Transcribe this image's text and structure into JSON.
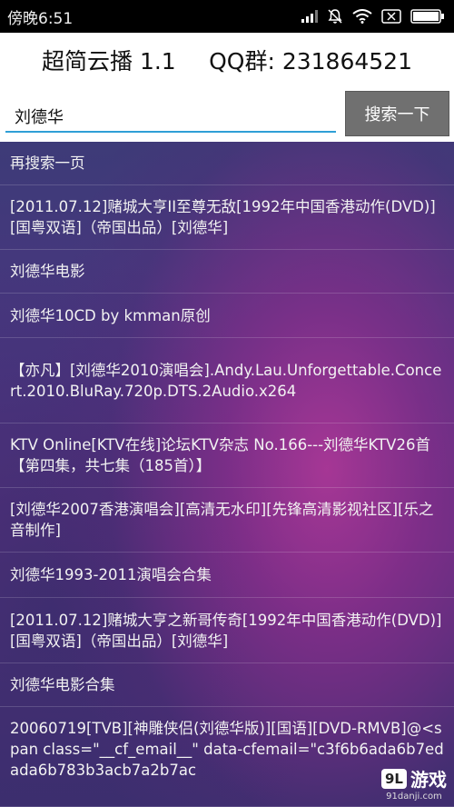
{
  "status_bar": {
    "time": "傍晚6:51",
    "icons": [
      "signal-icon",
      "bell-off-icon",
      "wifi-icon",
      "no-sim-icon",
      "battery-icon"
    ]
  },
  "header": {
    "title": "超简云播 1.1",
    "qq_group": "QQ群: 231864521"
  },
  "search": {
    "value": "刘德华",
    "button_label": "搜索一下"
  },
  "results": [
    "再搜索一页",
    "[2011.07.12]赌城大亨II至尊无敌[1992年中国香港动作(DVD)][国粤双语]（帝国出品）[刘德华]",
    "刘德华电影",
    "刘德华10CD by kmman原创",
    "【亦凡】[刘德华2010演唱会].Andy.Lau.Unforgettable.Concert.2010.BluRay.720p.DTS.2Audio.x264",
    "KTV Online[KTV在线]论坛KTV杂志 No.166---刘德华KTV26首【第四集，共七集（185首）】",
    "[刘德华2007香港演唱会][高清无水印][先锋高清影视社区][乐之音制作]",
    "刘德华1993-2011演唱会合集",
    "[2011.07.12]赌城大亨之新哥传奇[1992年中国香港动作(DVD)][国粤双语]（帝国出品）[刘德华]",
    "刘德华电影合集",
    "20060719[TVB][神雕侠侣(刘德华版)][国语][DVD-RMVB]@<span class=\"__cf_email__\" data-cfemail=\"c3f6b6ada6b7edada6b783b3acb7a2b7ac"
  ],
  "watermark": {
    "logo": "9L",
    "text": "游戏",
    "site": "91danji.com"
  },
  "colors": {
    "accent": "#2f9fd6",
    "button_bg": "#707070"
  }
}
